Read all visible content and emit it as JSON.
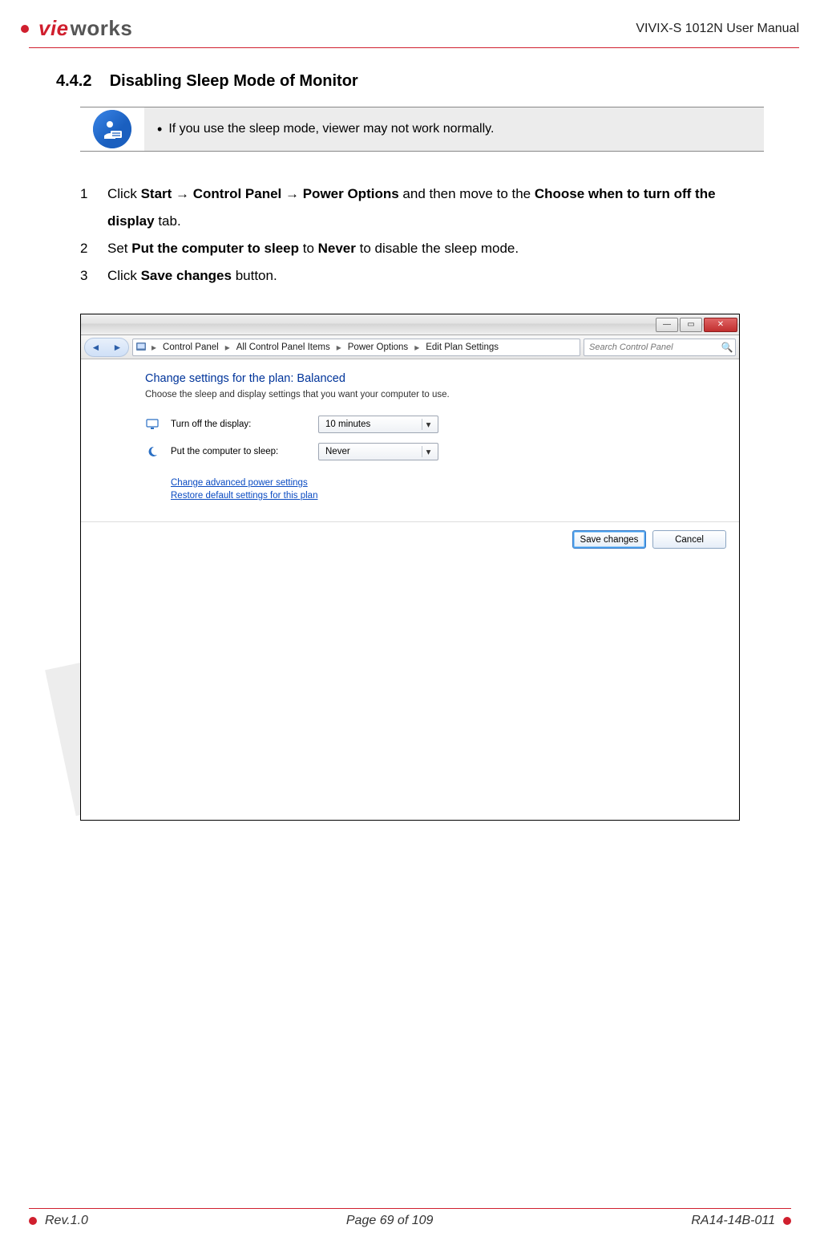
{
  "header": {
    "logo_part1": "vie",
    "logo_part2": "works",
    "manual_title": "VIVIX-S 1012N User Manual"
  },
  "section": {
    "number": "4.4.2",
    "title": "Disabling Sleep Mode of Monitor"
  },
  "note": {
    "text": "If you use the sleep mode, viewer may not work normally."
  },
  "steps": {
    "s1_prefix": "Click ",
    "s1_b1": "Start ",
    "arrow": "→",
    "s1_b2": " Control Panel ",
    "s1_b3": " Power Options",
    "s1_mid": " and then move to the ",
    "s1_b4": "Choose when to turn off the display",
    "s1_suffix": " tab.",
    "s2_prefix": "Set ",
    "s2_b1": "Put the computer to sleep",
    "s2_mid": " to ",
    "s2_b2": "Never",
    "s2_suffix": " to disable the sleep mode.",
    "s3_prefix": "Click ",
    "s3_b1": "Save changes",
    "s3_suffix": " button."
  },
  "win": {
    "breadcrumb": [
      "Control Panel",
      "All Control Panel Items",
      "Power Options",
      "Edit Plan Settings"
    ],
    "search_placeholder": "Search Control Panel",
    "plan_title": "Change settings for the plan: Balanced",
    "plan_desc": "Choose the sleep and display settings that you want your computer to use.",
    "turn_off_label": "Turn off the display:",
    "turn_off_value": "10 minutes",
    "sleep_label": "Put the computer to sleep:",
    "sleep_value": "Never",
    "link_advanced": "Change advanced power settings",
    "link_restore": "Restore default settings for this plan",
    "save_btn": "Save changes",
    "cancel_btn": "Cancel"
  },
  "footer": {
    "rev": "Rev.1.0",
    "page": "Page 69 of 109",
    "code": "RA14-14B-011"
  }
}
